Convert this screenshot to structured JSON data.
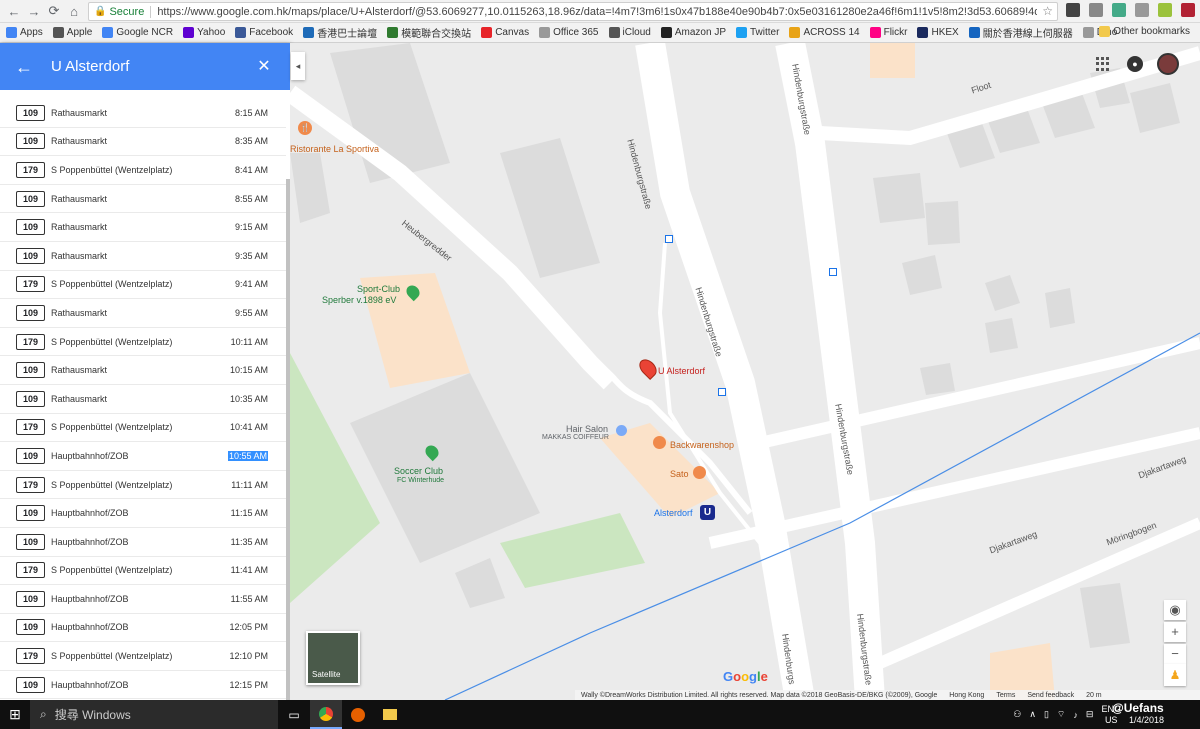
{
  "browser": {
    "secure_label": "Secure",
    "url": "https://www.google.com.hk/maps/place/U+Alsterdorf/@53.6069277,10.0115263,18.96z/data=!4m7!3m6!1s0x47b188e40e90b4b7:0x5e03161280e2a46f!6m1!1v5!8m2!3d53.60689!4d10.01..."
  },
  "bookmarks": {
    "items": [
      {
        "label": "Apps",
        "icon": "apps-grid-icon",
        "color": "#4285f4"
      },
      {
        "label": "Apple",
        "icon": "apple-icon",
        "color": "#555555"
      },
      {
        "label": "Google NCR",
        "icon": "google-icon",
        "color": "#4285f4"
      },
      {
        "label": "Yahoo",
        "icon": "yahoo-icon",
        "color": "#5f01d1"
      },
      {
        "label": "Facebook",
        "icon": "facebook-icon",
        "color": "#3b5998"
      },
      {
        "label": "香港巴士論壇",
        "icon": "bus-forum-icon",
        "color": "#1e6bb8"
      },
      {
        "label": "模範聯合交換站",
        "icon": "leaf-icon",
        "color": "#2f7a2f"
      },
      {
        "label": "Canvas",
        "icon": "canvas-icon",
        "color": "#e72429"
      },
      {
        "label": "Office 365",
        "icon": "page-icon",
        "color": "#999999"
      },
      {
        "label": "iCloud",
        "icon": "apple-icon",
        "color": "#555555"
      },
      {
        "label": "Amazon JP",
        "icon": "amazon-icon",
        "color": "#222222"
      },
      {
        "label": "Twitter",
        "icon": "twitter-icon",
        "color": "#1da1f2"
      },
      {
        "label": "ACROSS 14",
        "icon": "across-icon",
        "color": "#e8a317"
      },
      {
        "label": "Flickr",
        "icon": "flickr-icon",
        "color": "#ff0084"
      },
      {
        "label": "HKEX",
        "icon": "hkex-icon",
        "color": "#1b2a5e"
      },
      {
        "label": "關於香港線上伺服器",
        "icon": "server-icon",
        "color": "#1565c0"
      },
      {
        "label": "Dino",
        "icon": "page-icon",
        "color": "#999999"
      }
    ],
    "other_label": "Other bookmarks"
  },
  "panel": {
    "title": "U Alsterdorf",
    "departures": [
      {
        "route": "109",
        "destination": "Rathausmarkt",
        "time": "8:15 AM"
      },
      {
        "route": "109",
        "destination": "Rathausmarkt",
        "time": "8:35 AM"
      },
      {
        "route": "179",
        "destination": "S Poppenbüttel (Wentzelplatz)",
        "time": "8:41 AM"
      },
      {
        "route": "109",
        "destination": "Rathausmarkt",
        "time": "8:55 AM"
      },
      {
        "route": "109",
        "destination": "Rathausmarkt",
        "time": "9:15 AM"
      },
      {
        "route": "109",
        "destination": "Rathausmarkt",
        "time": "9:35 AM"
      },
      {
        "route": "179",
        "destination": "S Poppenbüttel (Wentzelplatz)",
        "time": "9:41 AM"
      },
      {
        "route": "109",
        "destination": "Rathausmarkt",
        "time": "9:55 AM"
      },
      {
        "route": "179",
        "destination": "S Poppenbüttel (Wentzelplatz)",
        "time": "10:11 AM"
      },
      {
        "route": "109",
        "destination": "Rathausmarkt",
        "time": "10:15 AM"
      },
      {
        "route": "109",
        "destination": "Rathausmarkt",
        "time": "10:35 AM"
      },
      {
        "route": "179",
        "destination": "S Poppenbüttel (Wentzelplatz)",
        "time": "10:41 AM"
      },
      {
        "route": "109",
        "destination": "Hauptbahnhof/ZOB",
        "time": "10:55 AM",
        "selected": true
      },
      {
        "route": "179",
        "destination": "S Poppenbüttel (Wentzelplatz)",
        "time": "11:11 AM"
      },
      {
        "route": "109",
        "destination": "Hauptbahnhof/ZOB",
        "time": "11:15 AM"
      },
      {
        "route": "109",
        "destination": "Hauptbahnhof/ZOB",
        "time": "11:35 AM"
      },
      {
        "route": "179",
        "destination": "S Poppenbüttel (Wentzelplatz)",
        "time": "11:41 AM"
      },
      {
        "route": "109",
        "destination": "Hauptbahnhof/ZOB",
        "time": "11:55 AM"
      },
      {
        "route": "109",
        "destination": "Hauptbahnhof/ZOB",
        "time": "12:05 PM"
      },
      {
        "route": "179",
        "destination": "S Poppenbüttel (Wentzelplatz)",
        "time": "12:10 PM"
      },
      {
        "route": "109",
        "destination": "Hauptbahnhof/ZOB",
        "time": "12:15 PM"
      }
    ]
  },
  "map": {
    "labels": {
      "ristorante": "Ristorante La Sportiva",
      "sport_club_1": "Sport-Club",
      "sport_club_2": "Sperber v.1898 eV",
      "u_alsterdorf": "U Alsterdorf",
      "hair_salon": "Hair Salon",
      "makkas": "MAKKAS COIFFEUR",
      "backwarenshop": "Backwarenshop",
      "sato": "Sato",
      "soccer_club": "Soccer Club",
      "fc_winterhude": "FC Winterhude",
      "alsterdorf_station": "Alsterdorf",
      "station_badge": "U",
      "hindenburg": "Hindenburgstraße",
      "hindenburg_short": "Hindenburgs",
      "heubergredder": "Heubergredder",
      "floot": "Floot",
      "djakartaweg": "Djakartaweg",
      "moringbogen": "Möringbogen"
    },
    "google_logo": "Google",
    "satellite_label": "Satellite",
    "footer": {
      "attribution": "Wally ©DreamWorks Distribution Limited. All rights reserved. Map data ©2018 GeoBasis-DE/BKG (©2009), Google",
      "region": "Hong Kong",
      "terms": "Terms",
      "feedback": "Send feedback",
      "scale": "20 m"
    },
    "colors": {
      "pin": "#ea4335",
      "poi_orange": "#f08a4b",
      "park_green": "#34a853",
      "transit_blue": "#1a73e8"
    }
  },
  "taskbar": {
    "search_placeholder": "搜尋 Windows",
    "lang_1": "ENG",
    "lang_2": "US",
    "time": "",
    "date": "1/4/2018",
    "watermark": "@Uefans"
  }
}
